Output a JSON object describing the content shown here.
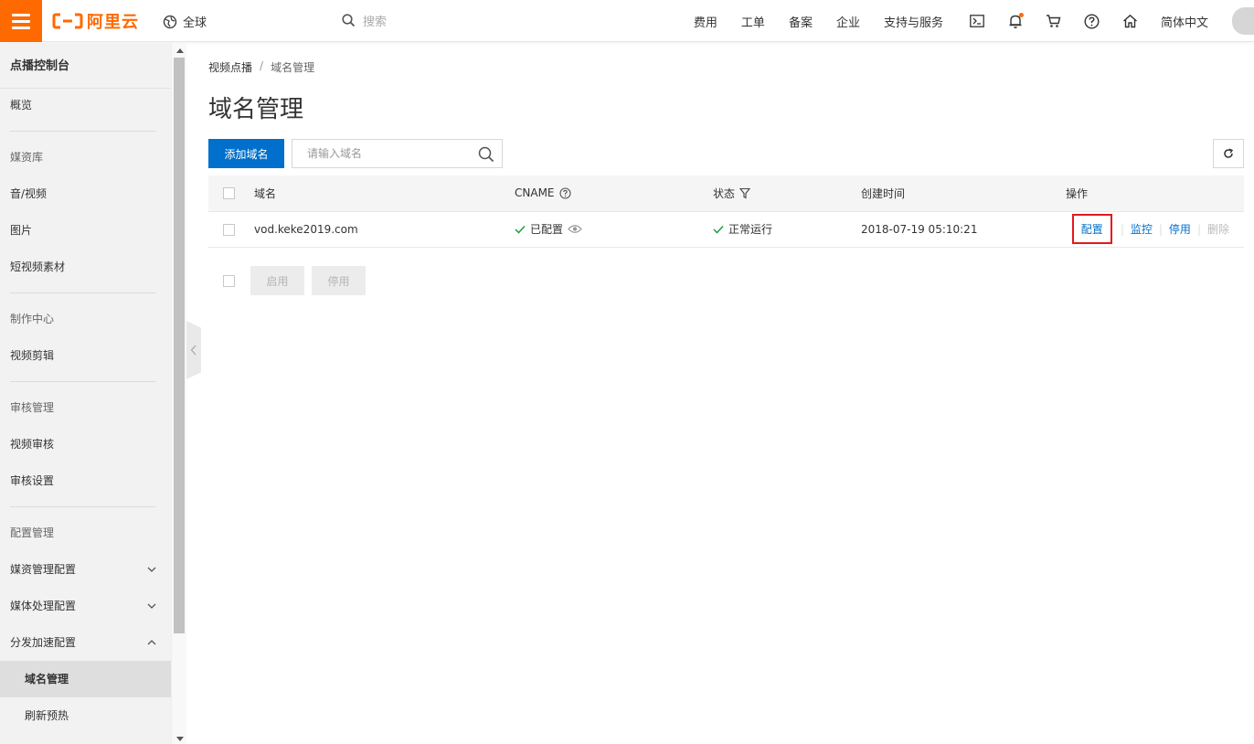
{
  "topbar": {
    "logo_text": "阿里云",
    "region_label": "全球",
    "search_placeholder": "搜索",
    "links": [
      "费用",
      "工单",
      "备案",
      "企业",
      "支持与服务"
    ],
    "language": "简体中文",
    "brand_color": "#ff6a00"
  },
  "sidebar": {
    "title": "点播控制台",
    "overview": "概览",
    "media_group": "媒资库",
    "media_items": [
      "音/视频",
      "图片",
      "短视频素材"
    ],
    "production_group": "制作中心",
    "production_items": [
      "视频剪辑"
    ],
    "review_group": "审核管理",
    "review_items": [
      "视频审核",
      "审核设置"
    ],
    "config_group": "配置管理",
    "config_items": [
      "媒资管理配置",
      "媒体处理配置",
      "分发加速配置"
    ],
    "cdn_items": [
      "域名管理",
      "刷新预热"
    ]
  },
  "breadcrumb": {
    "parent": "视频点播",
    "separator": "/",
    "current": "域名管理"
  },
  "page": {
    "title": "域名管理",
    "add_button": "添加域名",
    "search_placeholder": "请输入域名"
  },
  "table": {
    "headers": {
      "domain": "域名",
      "cname": "CNAME",
      "status": "状态",
      "created": "创建时间",
      "actions": "操作"
    },
    "rows": [
      {
        "domain": "vod.keke2019.com",
        "cname": "已配置",
        "status": "正常运行",
        "created": "2018-07-19 05:10:21",
        "actions": {
          "config": "配置",
          "monitor": "监控",
          "disable": "停用",
          "delete": "删除"
        }
      }
    ]
  },
  "bulk": {
    "enable": "启用",
    "disable": "停用"
  },
  "colors": {
    "primary": "#0070cc",
    "success": "#1d9e3a",
    "highlight": "#e4181c"
  }
}
